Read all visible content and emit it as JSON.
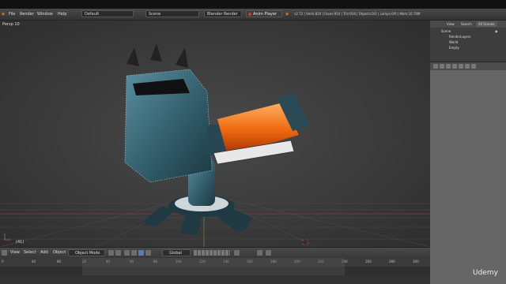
{
  "topbar": {
    "menu": [
      "File",
      "Render",
      "Window",
      "Help"
    ],
    "screen_layout": "Default",
    "scene": "Scene",
    "render_engine": "Blender Render",
    "anim_player_label": "Anim Player",
    "stats": "v2.72 | Verts:820 | Faces:914 | Tris:934 | Objects:0/2 | Lamps:0/0 | Mem:16.70M"
  },
  "viewport": {
    "view_label": "Persp 10",
    "object_label": "(41)"
  },
  "outliner": {
    "tabs": [
      "View",
      "Search",
      "All Scenes"
    ],
    "rows": [
      "Scene",
      "RenderLayers",
      "World",
      "Empty"
    ]
  },
  "bottombar": {
    "menu": [
      "View",
      "Select",
      "Add",
      "Object"
    ],
    "mode": "Object Mode",
    "pivot": "Global"
  },
  "timeline": {
    "ticks": [
      "0",
      "40",
      "80",
      "20",
      "40",
      "60",
      "80",
      "100",
      "120",
      "140",
      "160",
      "180",
      "200",
      "220",
      "240",
      "260",
      "280",
      "300"
    ]
  },
  "watermark": "Udemy"
}
